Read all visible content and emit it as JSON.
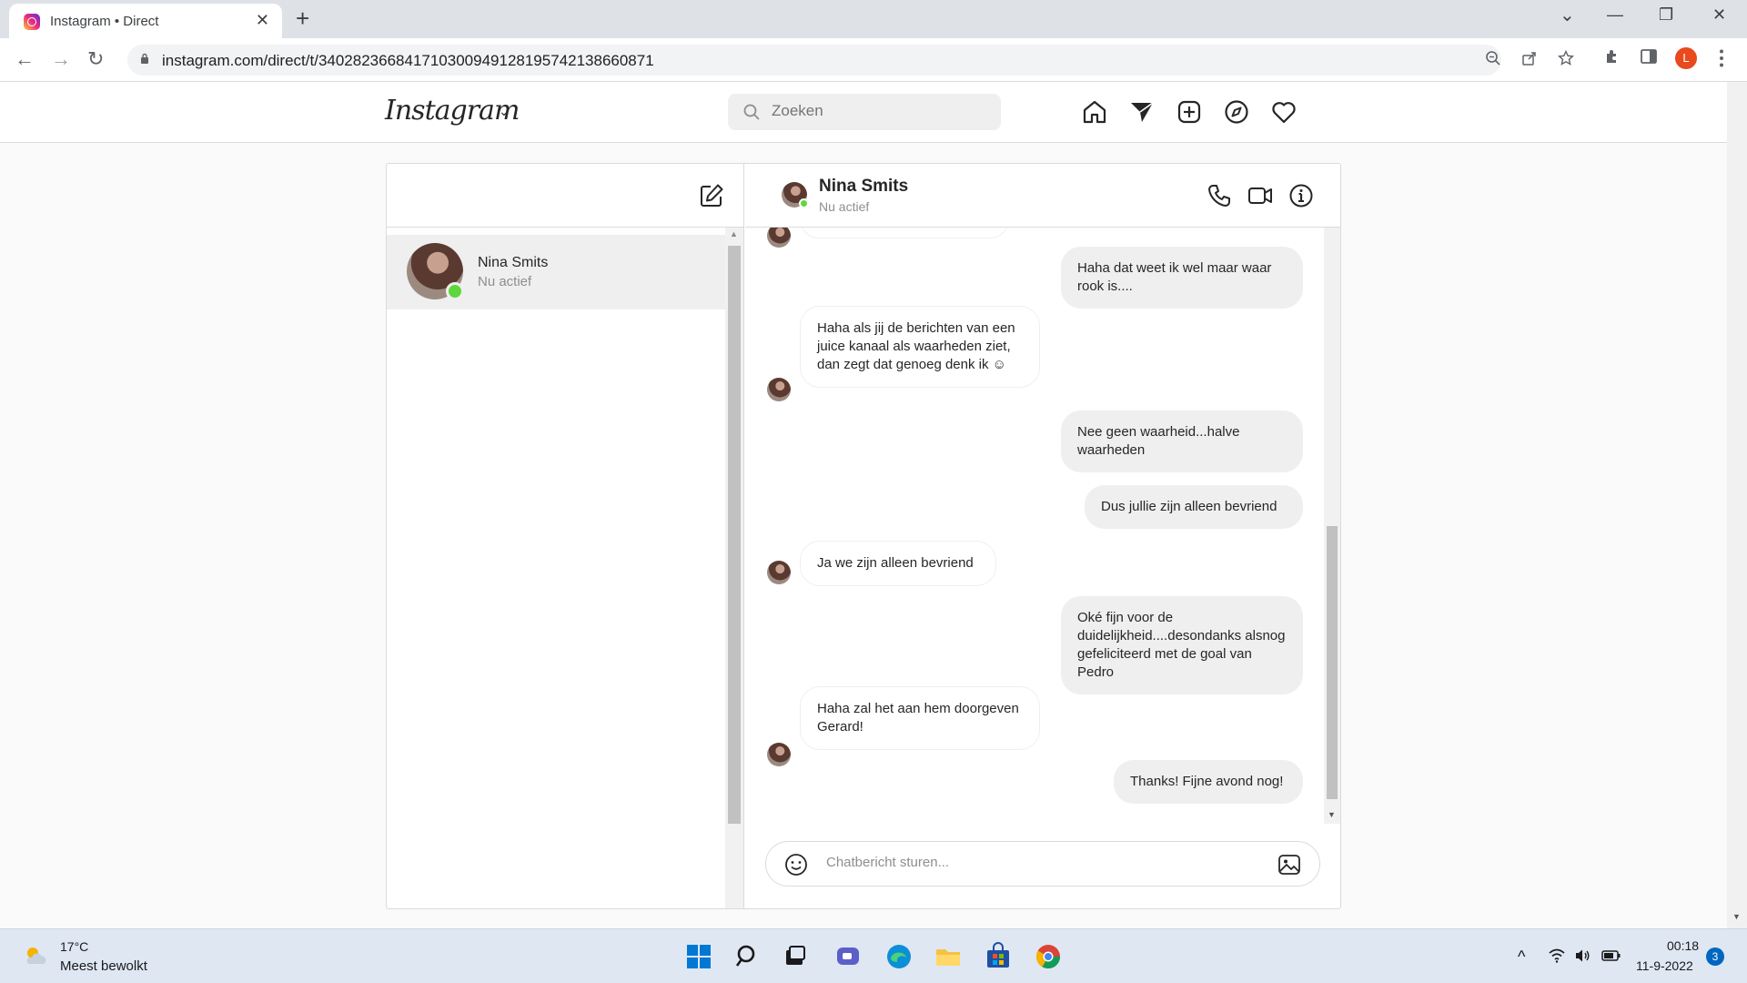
{
  "browser": {
    "tab_title": "Instagram • Direct",
    "tab_close": "✕",
    "new_tab": "+",
    "url": "instagram.com/direct/t/340282366841710300949128195742138660871",
    "profile_initial": "L",
    "controls": {
      "dropdown": "⌄",
      "minimize": "—",
      "restore": "❐",
      "close": "✕"
    },
    "nav": {
      "back": "←",
      "forward": "→",
      "reload": "↻"
    }
  },
  "instagram": {
    "logo": "Instagram",
    "logo_chevron": "⌄",
    "search_placeholder": "Zoeken"
  },
  "inbox": {
    "threads": [
      {
        "name": "Nina Smits",
        "status": "Nu actief",
        "online": true
      }
    ]
  },
  "chat": {
    "contact_name": "Nina Smits",
    "contact_status": "Nu actief",
    "messages": [
      {
        "from": "me",
        "text": "Haha dat weet ik wel maar waar rook is...."
      },
      {
        "from": "them",
        "text": "Haha als jij de berichten van een juice kanaal als waarheden ziet, dan zegt dat genoeg denk ik ☺"
      },
      {
        "from": "me",
        "text": "Nee geen waarheid...halve waarheden"
      },
      {
        "from": "me",
        "text": "Dus jullie zijn alleen bevriend"
      },
      {
        "from": "them",
        "text": "Ja we zijn alleen bevriend"
      },
      {
        "from": "me",
        "text": "Oké fijn voor de duidelijkheid....desondanks alsnog gefeliciteerd met de goal van Pedro"
      },
      {
        "from": "them",
        "text": "Haha zal het aan hem doorgeven Gerard!"
      },
      {
        "from": "me",
        "text": "Thanks! Fijne avond nog!"
      }
    ],
    "composer_placeholder": "Chatbericht sturen..."
  },
  "taskbar": {
    "weather_temp": "17°C",
    "weather_desc": "Meest bewolkt",
    "time": "00:18",
    "date": "11-9-2022",
    "notifications": "3",
    "tray": {
      "chevron": "^",
      "wifi": "◠",
      "volume": "🕪",
      "battery": "▭"
    }
  },
  "colors": {
    "accent_online": "#5fd63d",
    "bubble_out": "#efefef",
    "border": "#dbdbdb",
    "chrome_tabbar": "#dee1e6",
    "taskbar": "#dfe7f3"
  }
}
